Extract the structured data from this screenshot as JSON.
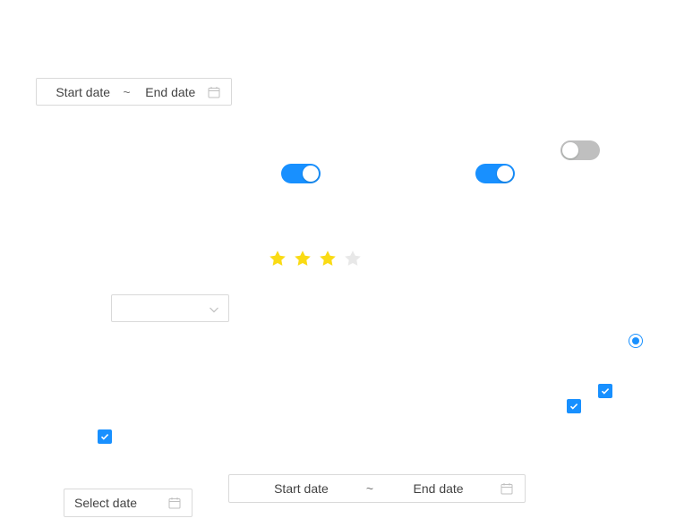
{
  "range_picker_top": {
    "start_placeholder": "Start date",
    "separator": "~",
    "end_placeholder": "End date",
    "icon": "calendar-icon"
  },
  "switches": [
    {
      "state": "off"
    },
    {
      "state": "on"
    },
    {
      "state": "on"
    }
  ],
  "rate": {
    "value": 3,
    "count": 4,
    "active_color": "#fadb14",
    "inactive_color": "#e8e8e8"
  },
  "select": {
    "value": "",
    "icon": "chevron-down-icon"
  },
  "radio": {
    "checked": true
  },
  "checkboxes": [
    {
      "checked": true
    },
    {
      "checked": true
    },
    {
      "checked": true
    }
  ],
  "date_picker": {
    "placeholder": "Select date",
    "icon": "calendar-icon"
  },
  "range_picker_bottom": {
    "start_placeholder": "Start date",
    "separator": "~",
    "end_placeholder": "End date",
    "icon": "calendar-icon"
  },
  "colors": {
    "primary": "#1890ff",
    "border": "#d9d9d9",
    "switch_off": "#bfbfbf"
  }
}
